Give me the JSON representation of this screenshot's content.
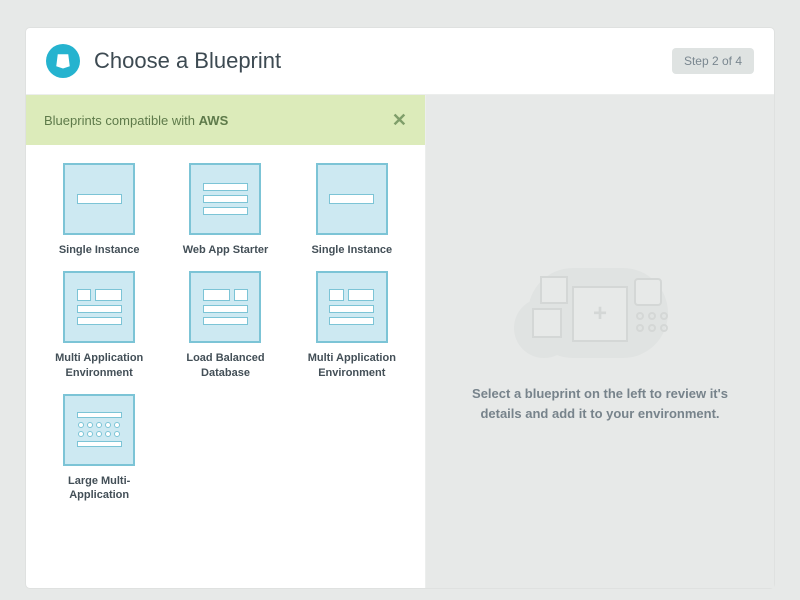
{
  "header": {
    "title": "Choose a Blueprint",
    "step_label": "Step 2 of 4"
  },
  "banner": {
    "prefix": "Blueprints compatible with ",
    "provider": "AWS"
  },
  "blueprints": [
    {
      "label": "Single Instance"
    },
    {
      "label": "Web App Starter"
    },
    {
      "label": "Single Instance"
    },
    {
      "label": "Multi Application Environment"
    },
    {
      "label": "Load Balanced Database"
    },
    {
      "label": "Multi Application Environment"
    },
    {
      "label": "Large Multi-Application"
    }
  ],
  "detail": {
    "placeholder_msg": "Select a blueprint on the left to review it's details and add it to your environment."
  }
}
